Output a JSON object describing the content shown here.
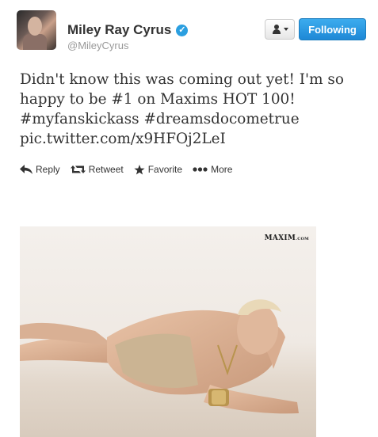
{
  "user": {
    "display_name": "Miley Ray Cyrus",
    "handle": "@MileyCyrus",
    "verified_glyph": "✓"
  },
  "header": {
    "follow_label": "Following",
    "dropdown_icon": "user-icon"
  },
  "tweet": {
    "lines": [
      "Didn't know this was coming out yet! I'm so",
      "happy to be #1 on Maxims HOT 100!",
      "#myfanskickass #dreamsdocometrue",
      "pic.twitter.com/x9HFOj2LeI"
    ]
  },
  "actions": {
    "reply": "Reply",
    "retweet": "Retweet",
    "favorite": "Favorite",
    "more": "More"
  },
  "photo": {
    "watermark": "MAXIM",
    "watermark_suffix": ".COM"
  },
  "colors": {
    "follow_button": "#2b9fe0",
    "verified": "#2b9fe0",
    "handle": "#999999"
  }
}
